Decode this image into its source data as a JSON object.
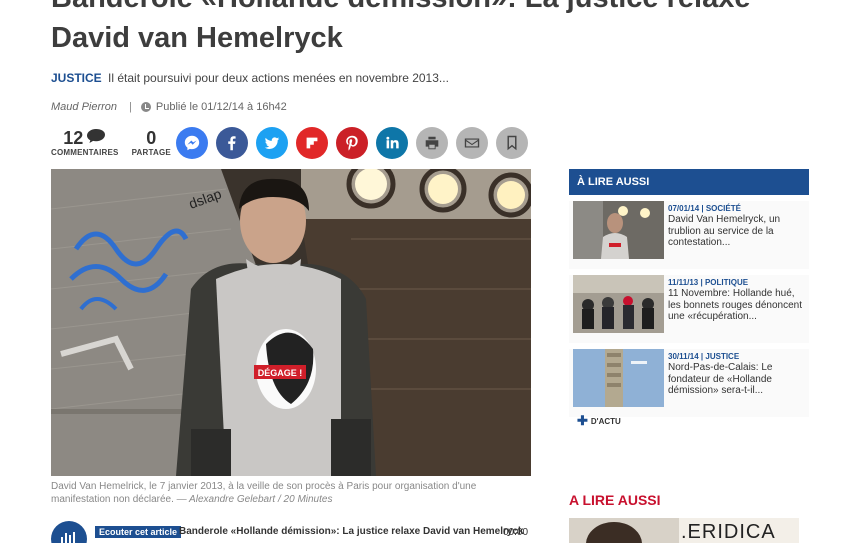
{
  "article": {
    "title_line1": "Banderole «Hollande démission»: La justice relaxe",
    "title_line2": "David van Hemelryck",
    "category": "JUSTICE",
    "lead": "Il était poursuivi pour deux actions menées en novembre 2013...",
    "author": "Maud Pierron",
    "separator": "|",
    "published": "Publié le 01/12/14 à 16h42"
  },
  "stats": {
    "comments_count": "12",
    "comments_label": "COMMENTAIRES",
    "shares_count": "0",
    "shares_label": "PARTAGE"
  },
  "share_buttons": [
    {
      "name": "messenger",
      "icon": "messenger-icon",
      "color": "#3b7bf0"
    },
    {
      "name": "facebook",
      "icon": "facebook-icon",
      "color": "#3b5998"
    },
    {
      "name": "twitter",
      "icon": "twitter-icon",
      "color": "#1da1f2"
    },
    {
      "name": "flipboard",
      "icon": "flipboard-icon",
      "color": "#e12828"
    },
    {
      "name": "pinterest",
      "icon": "pinterest-icon",
      "color": "#cb2027"
    },
    {
      "name": "linkedin",
      "icon": "linkedin-icon",
      "color": "#0e76a8"
    },
    {
      "name": "print",
      "icon": "print-icon",
      "color": "#b5b5b5"
    },
    {
      "name": "email",
      "icon": "email-icon",
      "color": "#b5b5b5"
    },
    {
      "name": "bookmark",
      "icon": "bookmark-icon",
      "color": "#b5b5b5"
    }
  ],
  "photo": {
    "tshirt_label": "DÉGAGE !",
    "caption": "David Van Hemelrick, le 7 janvier 2013, à la veille de son procès à Paris pour organisation d'une manifestation non déclarée.",
    "credit": "— Alexandre Gelebart / 20 Minutes"
  },
  "player": {
    "listen_label": "Ecouter cet article",
    "title": "Banderole «Hollande démission»: La justice relaxe David van Hemelryck",
    "time": "00:00"
  },
  "sidebar": {
    "heading": "À LIRE AUSSI",
    "items": [
      {
        "date": "07/01/14 | SOCIÉTÉ",
        "title": "David Van Hemelryck, un trublion au service de la contestation..."
      },
      {
        "date": "11/11/13 | POLITIQUE",
        "title": "11 Novembre: Hollande hué, les bonnets rouges dénoncent une «récupération..."
      },
      {
        "date": "30/11/14 | JUSTICE",
        "title": "Nord-Pas-de-Calais: Le fondateur de «Hollande démission» sera-t-il..."
      }
    ],
    "more_label": "D'ACTU",
    "heading2": "A LIRE AUSSI",
    "ad_text": ".ERIDICA"
  },
  "colors": {
    "brand": "#1d4f91",
    "accent_red": "#c8102e"
  }
}
